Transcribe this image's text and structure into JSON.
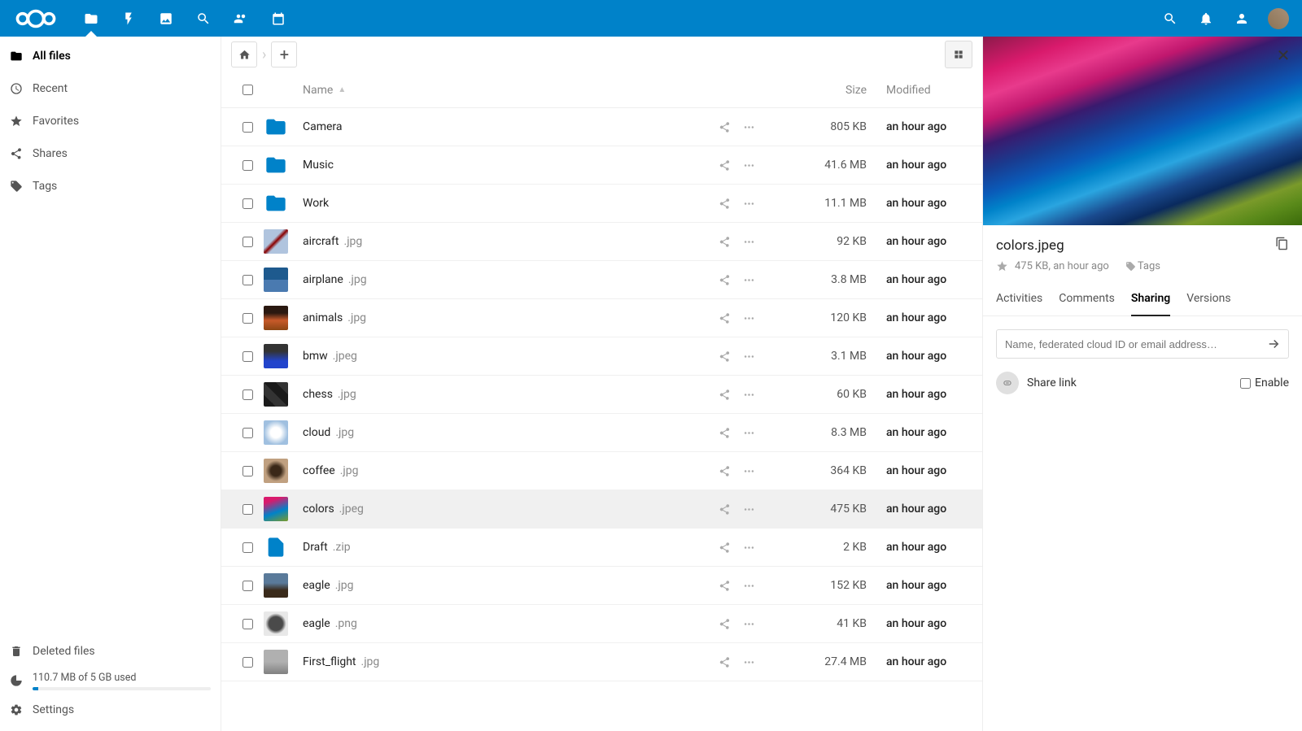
{
  "header": {
    "apps": [
      "files",
      "activity",
      "gallery",
      "search",
      "contacts",
      "calendar"
    ],
    "active_app": "files"
  },
  "sidebar": {
    "items": [
      {
        "id": "all",
        "label": "All files",
        "icon": "folder"
      },
      {
        "id": "recent",
        "label": "Recent",
        "icon": "clock"
      },
      {
        "id": "fav",
        "label": "Favorites",
        "icon": "star"
      },
      {
        "id": "shares",
        "label": "Shares",
        "icon": "share"
      },
      {
        "id": "tags",
        "label": "Tags",
        "icon": "tag"
      }
    ],
    "active": "all",
    "deleted_label": "Deleted files",
    "quota_text": "110.7 MB of 5 GB used",
    "settings_label": "Settings"
  },
  "columns": {
    "name": "Name",
    "size": "Size",
    "modified": "Modified"
  },
  "sort": {
    "col": "name",
    "dir": "asc"
  },
  "files": [
    {
      "type": "folder",
      "name": "Camera",
      "ext": "",
      "size": "805 KB",
      "mod": "an hour ago",
      "thumb": ""
    },
    {
      "type": "folder",
      "name": "Music",
      "ext": "",
      "size": "41.6 MB",
      "mod": "an hour ago",
      "thumb": ""
    },
    {
      "type": "folder",
      "name": "Work",
      "ext": "",
      "size": "11.1 MB",
      "mod": "an hour ago",
      "thumb": ""
    },
    {
      "type": "img",
      "name": "aircraft",
      "ext": ".jpg",
      "size": "92 KB",
      "mod": "an hour ago",
      "thumb": "linear-gradient(135deg,#b0c4de 40%,#8b0000 50%,#b0c4de 60%)"
    },
    {
      "type": "img",
      "name": "airplane",
      "ext": ".jpg",
      "size": "3.8 MB",
      "mod": "an hour ago",
      "thumb": "linear-gradient(180deg,#1e5a8e 50%,#4a7ab0 50%)"
    },
    {
      "type": "img",
      "name": "animals",
      "ext": ".jpg",
      "size": "120 KB",
      "mod": "an hour ago",
      "thumb": "linear-gradient(180deg,#2a1810 30%,#c85a2a 60%,#8b4513 100%)"
    },
    {
      "type": "img",
      "name": "bmw",
      "ext": ".jpeg",
      "size": "3.1 MB",
      "mod": "an hour ago",
      "thumb": "linear-gradient(180deg,#333 30%,#2244cc 70%)"
    },
    {
      "type": "img",
      "name": "chess",
      "ext": ".jpg",
      "size": "60 KB",
      "mod": "an hour ago",
      "thumb": "linear-gradient(45deg,#1a1a1a 25%,#333 25%,#333 50%,#1a1a1a 50%,#1a1a1a 75%,#333 75%)"
    },
    {
      "type": "img",
      "name": "cloud",
      "ext": ".jpg",
      "size": "8.3 MB",
      "mod": "an hour ago",
      "thumb": "radial-gradient(circle,#fff 30%,#a0c0e0 70%)"
    },
    {
      "type": "img",
      "name": "coffee",
      "ext": ".jpg",
      "size": "364 KB",
      "mod": "an hour ago",
      "thumb": "radial-gradient(circle,#3a2818 30%,#c0a080 60%)"
    },
    {
      "type": "img",
      "name": "colors",
      "ext": ".jpeg",
      "size": "475 KB",
      "mod": "an hour ago",
      "thumb": "linear-gradient(160deg,#d91a6c 20%,#0082c9 60%,#7a9a2a 100%)",
      "selected": true
    },
    {
      "type": "file",
      "name": "Draft",
      "ext": ".zip",
      "size": "2 KB",
      "mod": "an hour ago",
      "thumb": ""
    },
    {
      "type": "img",
      "name": "eagle",
      "ext": ".jpg",
      "size": "152 KB",
      "mod": "an hour ago",
      "thumb": "linear-gradient(180deg,#5a7a9a 40%,#3a2a1a 70%)"
    },
    {
      "type": "img",
      "name": "eagle",
      "ext": ".png",
      "size": "41 KB",
      "mod": "an hour ago",
      "thumb": "radial-gradient(circle,#4a4a4a 40%,#e8e8e8 60%)"
    },
    {
      "type": "img",
      "name": "First_flight",
      "ext": ".jpg",
      "size": "27.4 MB",
      "mod": "an hour ago",
      "thumb": "linear-gradient(180deg,#b0b0b0 50%,#808080 100%)"
    }
  ],
  "detail": {
    "filename": "colors.jpeg",
    "size": "475 KB",
    "modified": "an hour ago",
    "tags_label": "Tags",
    "tabs": [
      "Activities",
      "Comments",
      "Sharing",
      "Versions"
    ],
    "active_tab": "Sharing",
    "share_placeholder": "Name, federated cloud ID or email address…",
    "share_link_label": "Share link",
    "enable_label": "Enable"
  }
}
